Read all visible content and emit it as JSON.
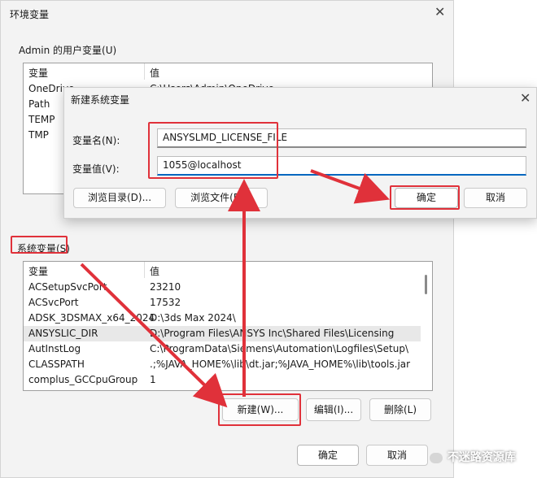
{
  "env_dialog": {
    "title": "环境变量",
    "user_group": {
      "label": "Admin 的用户变量(U)",
      "col_var": "变量",
      "col_val": "值",
      "rows": [
        {
          "name": "OneDrive",
          "value": "C:\\Users\\Admin\\OneDrive"
        },
        {
          "name": "Path",
          "value": ""
        },
        {
          "name": "TEMP",
          "value": ""
        },
        {
          "name": "TMP",
          "value": ""
        }
      ]
    },
    "system_group": {
      "label": "系统变量(S)",
      "col_var": "变量",
      "col_val": "值",
      "rows": [
        {
          "name": "ACSetupSvcPort",
          "value": "23210"
        },
        {
          "name": "ACSvcPort",
          "value": "17532"
        },
        {
          "name": "ADSK_3DSMAX_x64_2024",
          "value": "D:\\3ds Max 2024\\"
        },
        {
          "name": "ANSYSLIC_DIR",
          "value": "D:\\Program Files\\ANSYS Inc\\Shared Files\\Licensing"
        },
        {
          "name": "AutInstLog",
          "value": "C:\\ProgramData\\Siemens\\Automation\\Logfiles\\Setup\\"
        },
        {
          "name": "CLASSPATH",
          "value": ".;%JAVA_HOME%\\lib\\dt.jar;%JAVA_HOME%\\lib\\tools.jar"
        },
        {
          "name": "complus_GCCpuGroup",
          "value": "1"
        }
      ],
      "selected_index": 3,
      "new_button": "新建(W)...",
      "edit_button": "编辑(I)...",
      "delete_button": "删除(L)"
    },
    "ok_button": "确定",
    "cancel_button": "取消"
  },
  "new_var_dialog": {
    "title": "新建系统变量",
    "name_label": "变量名(N):",
    "name_value": "ANSYSLMD_LICENSE_FILE",
    "value_label": "变量值(V):",
    "value_value": "1055@localhost",
    "browse_dir_button": "浏览目录(D)...",
    "browse_file_button": "浏览文件(F)...",
    "ok_button": "确定",
    "cancel_button": "取消"
  },
  "watermark": "不迷路资源库",
  "colors": {
    "annotation": "#e0313a",
    "focus": "#0067c0"
  }
}
